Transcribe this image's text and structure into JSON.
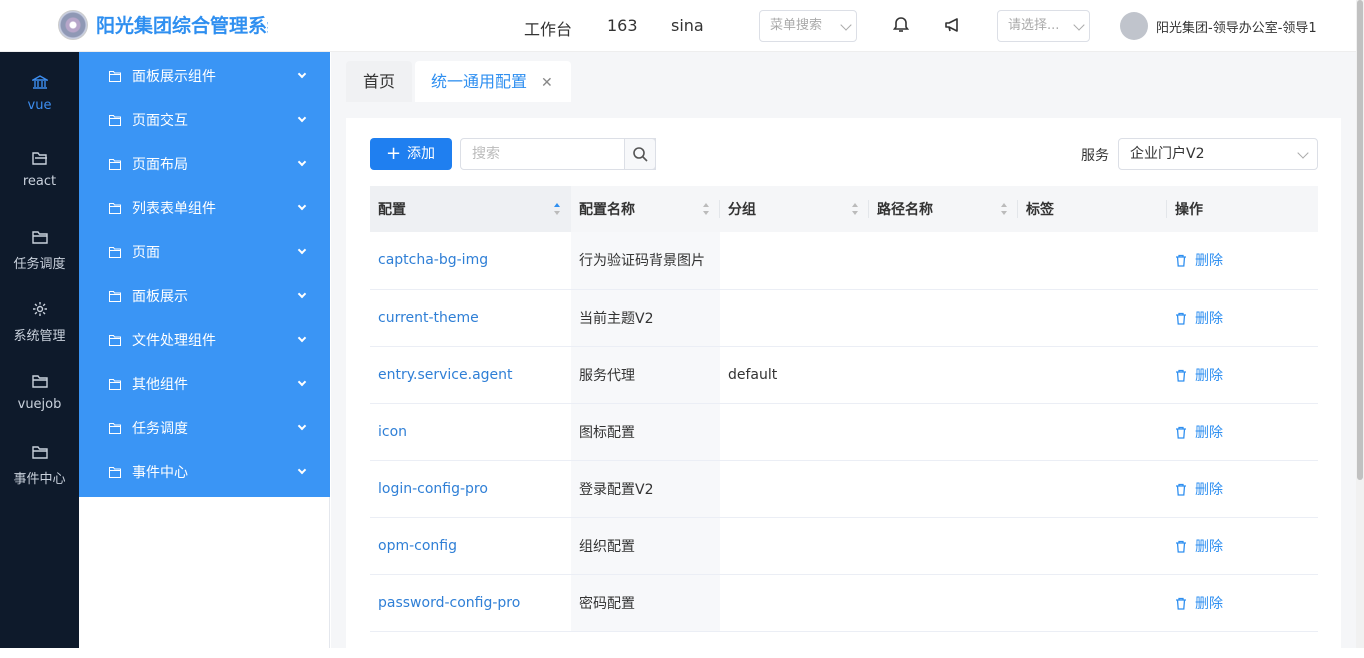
{
  "header": {
    "app_title": "阳光集团综合管理系统",
    "links": [
      "工作台",
      "163",
      "sina"
    ],
    "menu_search_placeholder": "菜单搜索",
    "select_placeholder": "请选择...",
    "user": "阳光集团-领导办公室-领导1",
    "icons": [
      "bell-icon",
      "megaphone-icon"
    ]
  },
  "sidebar": {
    "items": [
      {
        "label": "vue",
        "icon": "bank-icon",
        "active": true
      },
      {
        "label": "react",
        "icon": "folder-open-icon"
      },
      {
        "label": "任务调度",
        "icon": "folder-icon"
      },
      {
        "label": "系统管理",
        "icon": "gear-icon"
      },
      {
        "label": "vuejob",
        "icon": "folder-icon"
      },
      {
        "label": "事件中心",
        "icon": "folder-icon"
      }
    ]
  },
  "submenu": {
    "items": [
      "面板展示组件",
      "页面交互",
      "页面布局",
      "列表表单组件",
      "页面",
      "面板展示",
      "文件处理组件",
      "其他组件",
      "任务调度",
      "事件中心"
    ]
  },
  "tabs": [
    {
      "label": "首页"
    },
    {
      "label": "统一通用配置",
      "active": true
    }
  ],
  "toolbar": {
    "add_label": "添加",
    "search_placeholder": "搜索",
    "service_label": "服务",
    "service_value": "企业门户V2"
  },
  "table": {
    "columns": [
      "配置",
      "配置名称",
      "分组",
      "路径名称",
      "标签",
      "操作"
    ],
    "rows": [
      {
        "key": "captcha-bg-img",
        "name": "行为验证码背景图片",
        "group": "",
        "path": "",
        "tag": "",
        "op": "删除"
      },
      {
        "key": "current-theme",
        "name": "当前主题V2",
        "group": "",
        "path": "",
        "tag": "",
        "op": "删除"
      },
      {
        "key": "entry.service.agent",
        "name": "服务代理",
        "group": "default",
        "path": "",
        "tag": "",
        "op": "删除"
      },
      {
        "key": "icon",
        "name": "图标配置",
        "group": "",
        "path": "",
        "tag": "",
        "op": "删除"
      },
      {
        "key": "login-config-pro",
        "name": "登录配置V2",
        "group": "",
        "path": "",
        "tag": "",
        "op": "删除"
      },
      {
        "key": "opm-config",
        "name": "组织配置",
        "group": "",
        "path": "",
        "tag": "",
        "op": "删除"
      },
      {
        "key": "password-config-pro",
        "name": "密码配置",
        "group": "",
        "path": "",
        "tag": "",
        "op": "删除"
      }
    ]
  },
  "colors": {
    "accent": "#2f8ff0",
    "sidebar": "#0e1a2b",
    "submenu": "#3a95f5"
  }
}
